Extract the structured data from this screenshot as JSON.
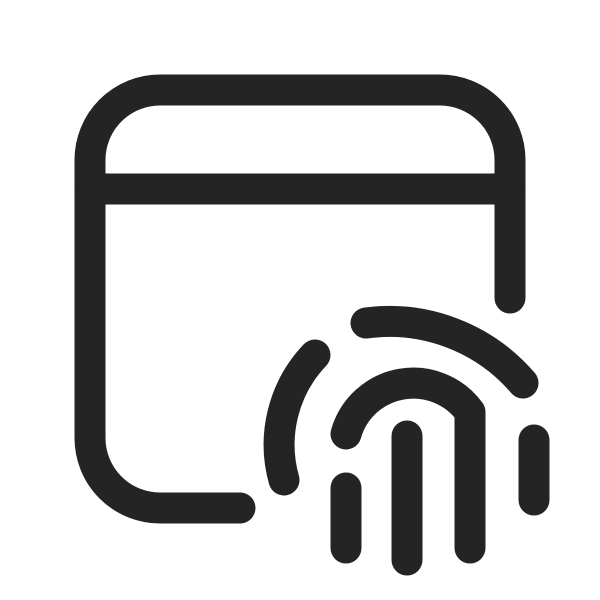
{
  "icon": {
    "name": "window-fingerprint-icon",
    "stroke_color": "#242424",
    "background_color": "#ffffff"
  }
}
